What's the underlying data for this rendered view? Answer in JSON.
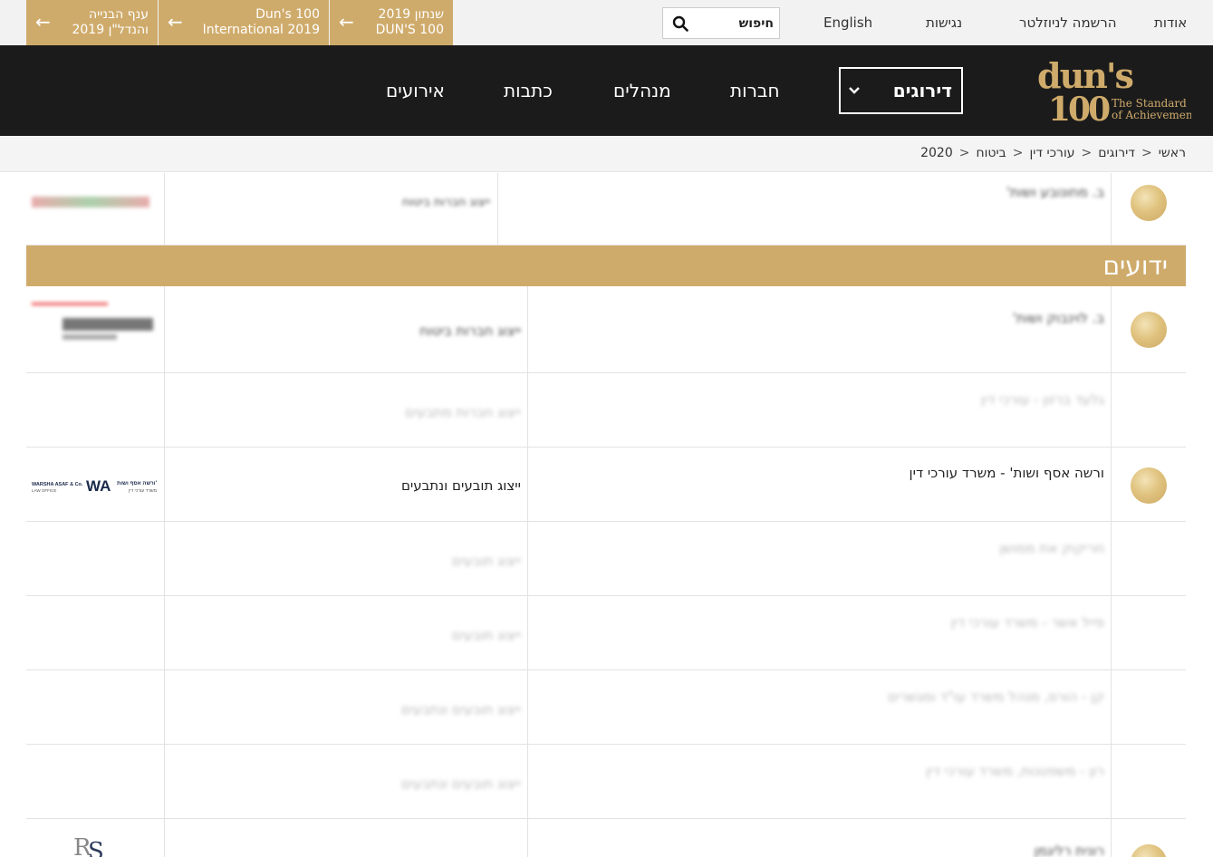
{
  "promos": [
    {
      "line1": "ענף הבנייה",
      "line2": "והנדל\"ן 2019"
    },
    {
      "line1": "Dun's 100",
      "line2": "International 2019"
    },
    {
      "line1": "שנתון 2019",
      "line2": "DUN'S 100"
    }
  ],
  "search": {
    "placeholder": "חיפוש"
  },
  "util_links": {
    "english": "English",
    "accessibility": "נגישות",
    "newsletter": "הרשמה לניוזלטר",
    "about": "אודות"
  },
  "logo": {
    "brand_top": "dun's",
    "brand_bottom": "100",
    "tagline1": "The Standard",
    "tagline2": "of Achievement"
  },
  "nav": {
    "rankings": "דירוגים",
    "companies": "חברות",
    "managers": "מנהלים",
    "articles": "כתבות",
    "events": "אירועים"
  },
  "breadcrumb": [
    "ראשי",
    "דירוגים",
    "עורכי דין",
    "ביטוח",
    "2020"
  ],
  "section": {
    "title": "ידועים"
  },
  "rows": [
    {
      "name": "ורשה אסף ושות' - משרד עורכי דין",
      "category": "ייצוג תובעים ונתבעים",
      "logo_text": "ורשה אסף ושות' WARSHA ASAF & Co. LAW OFFICE"
    }
  ],
  "colors": {
    "gold": "#cfab6b",
    "nav_bg": "#1b1b1b",
    "topbar_bg": "#f2f2f2"
  }
}
